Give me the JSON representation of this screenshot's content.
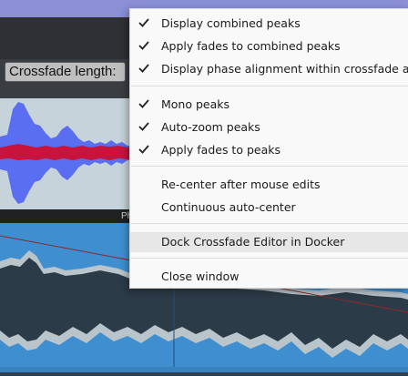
{
  "editor": {
    "crossfade_label": "Crossfade length:",
    "bottom_label": "Ph"
  },
  "menu": {
    "items": [
      {
        "label": "Display combined peaks",
        "checked": true
      },
      {
        "label": "Apply fades to combined peaks",
        "checked": true
      },
      {
        "label": "Display phase alignment within crossfade are",
        "checked": true
      },
      {
        "label": "Mono peaks",
        "checked": true
      },
      {
        "label": "Auto-zoom peaks",
        "checked": true
      },
      {
        "label": "Apply fades to peaks",
        "checked": true
      },
      {
        "label": "Re-center after mouse edits",
        "checked": false
      },
      {
        "label": "Continuous auto-center",
        "checked": false
      },
      {
        "label": "Dock Crossfade Editor in Docker",
        "checked": false,
        "highlighted": true
      },
      {
        "label": "Close window",
        "checked": false
      }
    ]
  },
  "colors": {
    "menu_bg": "#f9f9f9",
    "menu_highlight": "#e7e7e7",
    "track_bg": "#3f8fd0",
    "waveform_dark": "#2c3b48",
    "waveform_light": "#b9c4cb",
    "editor_peak_blue": "#5a6ef2",
    "editor_peak_red": "#c8143c"
  }
}
